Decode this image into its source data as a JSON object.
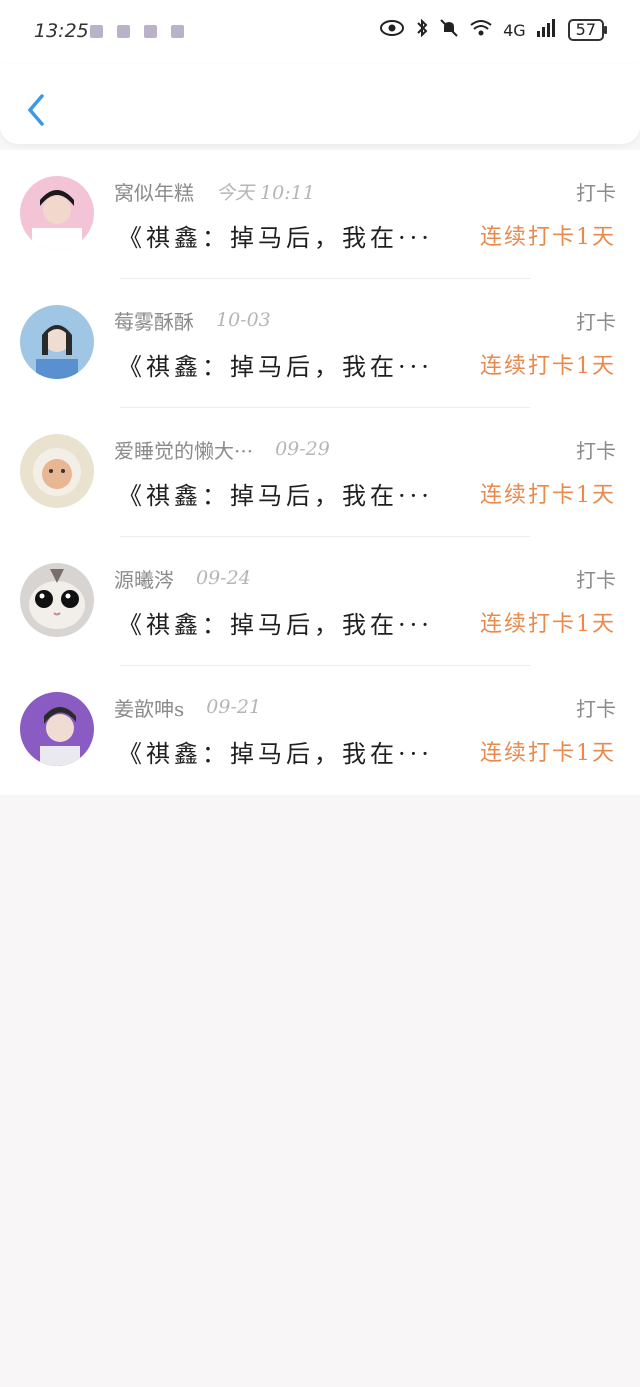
{
  "status_bar": {
    "time": "13:25",
    "battery": "57",
    "network": "4G"
  },
  "feed": {
    "items": [
      {
        "username": "窝似年糕",
        "time": "今天 10:11",
        "action": "打卡",
        "content": "《祺鑫：掉马后，我在···",
        "streak": "连续打卡1天"
      },
      {
        "username": "莓雾酥酥",
        "time": "10-03",
        "action": "打卡",
        "content": "《祺鑫：掉马后，我在···",
        "streak": "连续打卡1天"
      },
      {
        "username": "爱睡觉的懒大···",
        "time": "09-29",
        "action": "打卡",
        "content": "《祺鑫：掉马后，我在···",
        "streak": "连续打卡1天"
      },
      {
        "username": "源曦涔",
        "time": "09-24",
        "action": "打卡",
        "content": "《祺鑫：掉马后，我在···",
        "streak": "连续打卡1天"
      },
      {
        "username": "姜歆呻s",
        "time": "09-21",
        "action": "打卡",
        "content": "《祺鑫：掉马后，我在···",
        "streak": "连续打卡1天"
      }
    ]
  },
  "colors": {
    "accent_blue": "#3b9ae1",
    "streak_orange": "#e9894c"
  }
}
